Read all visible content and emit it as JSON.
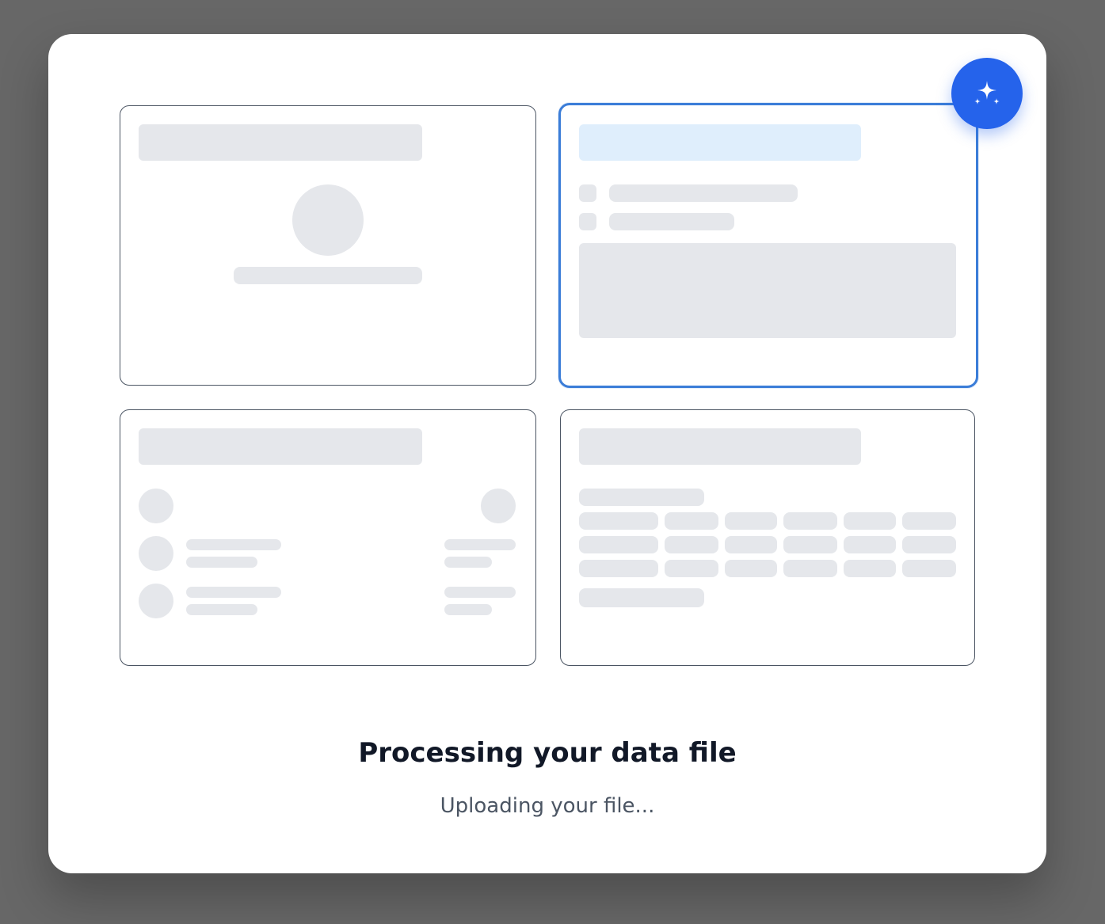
{
  "dialog": {
    "title": "Processing your data file",
    "status": "Uploading your file..."
  },
  "ai_button": {
    "icon": "sparkles-icon",
    "color": "#2563eb"
  },
  "colors": {
    "skeleton": "#e5e7eb",
    "skeleton_highlight": "#dfeefc",
    "active_border": "#3b7dd8",
    "card_border": "#4b5563"
  }
}
